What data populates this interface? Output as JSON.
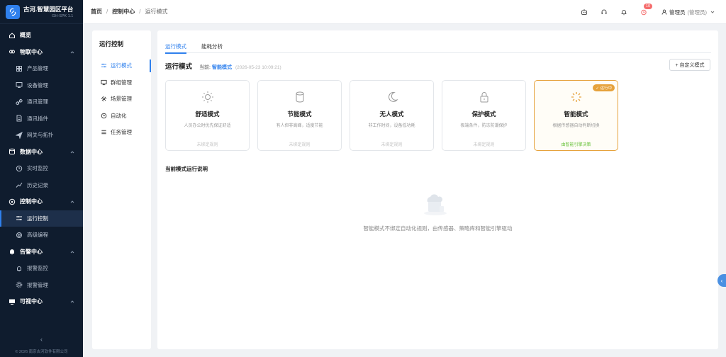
{
  "brand": {
    "title": "古河.智慧园区平台",
    "subtitle": "GH-SPK 1.1"
  },
  "sidebar": {
    "items": [
      {
        "label": "概览",
        "type": "group",
        "icon": "home-icon"
      },
      {
        "label": "物联中心",
        "type": "group",
        "icon": "link-icon",
        "caret": "^"
      },
      {
        "label": "产品管理",
        "type": "sub",
        "icon": "grid-icon"
      },
      {
        "label": "设备管理",
        "type": "sub",
        "icon": "monitor-icon"
      },
      {
        "label": "通讯管理",
        "type": "sub",
        "icon": "chain-icon"
      },
      {
        "label": "通讯插件",
        "type": "sub",
        "icon": "document-icon"
      },
      {
        "label": "网关与拓扑",
        "type": "sub",
        "icon": "send-icon"
      },
      {
        "label": "数据中心",
        "type": "group",
        "icon": "database-icon",
        "caret": "^"
      },
      {
        "label": "实时监控",
        "type": "sub",
        "icon": "clock-icon"
      },
      {
        "label": "历史记录",
        "type": "sub",
        "icon": "chart-line-icon"
      },
      {
        "label": "控制中心",
        "type": "group",
        "icon": "control-icon",
        "caret": "^"
      },
      {
        "label": "运行控制",
        "type": "sub",
        "icon": "sliders-icon",
        "active": true
      },
      {
        "label": "高级编程",
        "type": "sub",
        "icon": "code-icon"
      },
      {
        "label": "告警中心",
        "type": "group",
        "icon": "bell-icon",
        "caret": "^"
      },
      {
        "label": "报警监控",
        "type": "sub",
        "icon": "bell-outline-icon"
      },
      {
        "label": "报警管理",
        "type": "sub",
        "icon": "gear-icon"
      },
      {
        "label": "可视中心",
        "type": "group",
        "icon": "screen-icon",
        "caret": "^"
      }
    ],
    "collapse_glyph": "‹",
    "copyright": "© 2026 南京古河软件有限公司"
  },
  "header": {
    "breadcrumb": [
      "首页",
      "控制中心",
      "运行模式"
    ],
    "notification_count": "10",
    "user_name": "管理员",
    "user_role": "(管理员)"
  },
  "leftpanel": {
    "title": "运行控制",
    "items": [
      {
        "label": "运行模式",
        "icon": "sliders-icon",
        "active": true
      },
      {
        "label": "群组管理",
        "icon": "monitor-icon"
      },
      {
        "label": "场景管理",
        "icon": "scene-icon"
      },
      {
        "label": "自动化",
        "icon": "clock-icon"
      },
      {
        "label": "任务管理",
        "icon": "list-icon"
      }
    ]
  },
  "main": {
    "tabs": [
      {
        "label": "运行模式",
        "active": true
      },
      {
        "label": "能耗分析"
      }
    ],
    "mode_title": "运行模式",
    "current_label": "当前:",
    "current_mode": "智能模式",
    "current_time": "(2026-05-23 10:09:21)",
    "custom_button": "+ 自定义模式",
    "cards": [
      {
        "name": "舒适模式",
        "desc": "人员办公时优先保证舒适",
        "rule": "未绑定规则",
        "icon": "sun-icon"
      },
      {
        "name": "节能模式",
        "desc": "有人但非高峰，适度节能",
        "rule": "未绑定规则",
        "icon": "cylinder-icon"
      },
      {
        "name": "无人模式",
        "desc": "非工作时间，设备低功耗",
        "rule": "未绑定规则",
        "icon": "moon-icon"
      },
      {
        "name": "保护模式",
        "desc": "极端条件，防冻防潮保护",
        "rule": "未绑定规则",
        "icon": "lock-icon"
      },
      {
        "name": "智能模式",
        "desc": "根据传感器自动判断切换",
        "rule": "由智能引擎决策",
        "icon": "spinner-icon",
        "active": true,
        "badge": "✓ 运行中"
      }
    ],
    "desc_title": "当前模式运行说明",
    "empty_text": "智能模式不绑定自动化规则，由传感器、策略库和智能引擎驱动"
  },
  "colors": {
    "accent": "#2f80ed",
    "sidebar_bg": "#0f1c2e",
    "running": "#e6a23c",
    "engine": "#67c23a"
  }
}
